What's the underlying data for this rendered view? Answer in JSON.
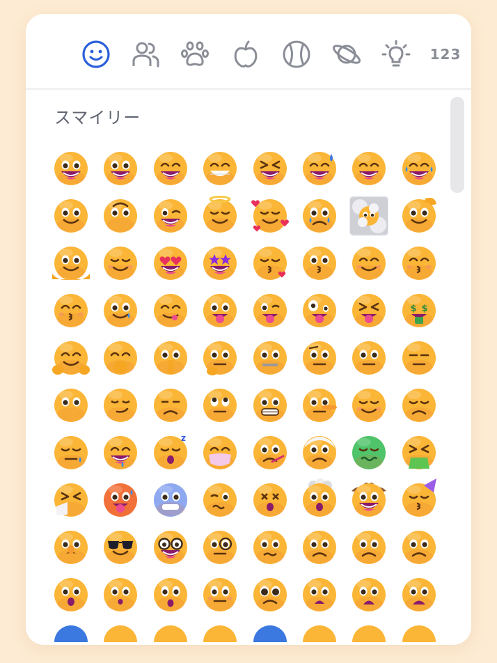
{
  "tabs": [
    {
      "name": "smileys-tab",
      "icon": "smiley-icon",
      "active": true
    },
    {
      "name": "people-tab",
      "icon": "people-icon"
    },
    {
      "name": "animals-tab",
      "icon": "paw-icon"
    },
    {
      "name": "food-tab",
      "icon": "apple-icon"
    },
    {
      "name": "activities-tab",
      "icon": "ball-icon"
    },
    {
      "name": "travel-tab",
      "icon": "planet-icon"
    },
    {
      "name": "objects-tab",
      "icon": "lightbulb-icon"
    },
    {
      "name": "symbols-tab",
      "icon": "numbers-icon",
      "label": "123"
    }
  ],
  "section": {
    "title": "スマイリー"
  },
  "colors": {
    "accent": "#2b5fd9",
    "tab_gray": "#8a8d96",
    "face": "#fbb637",
    "bg": "#fdebd3"
  },
  "emojis": [
    {
      "name": "grinning-face",
      "kind": "grin",
      "color": "#fbb637"
    },
    {
      "name": "grinning-face-big-eyes",
      "kind": "grin",
      "color": "#fbb637"
    },
    {
      "name": "grinning-face-smiling-eyes",
      "kind": "happyeyes",
      "color": "#fbb637"
    },
    {
      "name": "beaming-face",
      "kind": "beam",
      "color": "#fbb637"
    },
    {
      "name": "grinning-squinting-face",
      "kind": "squint",
      "color": "#fbb637"
    },
    {
      "name": "grinning-face-sweat",
      "kind": "sweat",
      "color": "#fbb637"
    },
    {
      "name": "rolling-on-floor-laughing",
      "kind": "rofl",
      "color": "#fbb637"
    },
    {
      "name": "face-tears-of-joy",
      "kind": "tears",
      "color": "#fbb637"
    },
    {
      "name": "slightly-smiling-face",
      "kind": "slight",
      "color": "#fbb637"
    },
    {
      "name": "upside-down-face",
      "kind": "upside",
      "color": "#fbb637"
    },
    {
      "name": "winking-face",
      "kind": "wink",
      "color": "#fbb637"
    },
    {
      "name": "smiling-face-halo",
      "kind": "halo",
      "color": "#fbb637"
    },
    {
      "name": "smiling-face-hearts",
      "kind": "hearts",
      "color": "#fbb637"
    },
    {
      "name": "face-holding-back-tears",
      "kind": "holdtears",
      "color": "#fbb637"
    },
    {
      "name": "face-in-clouds",
      "kind": "clouds",
      "color": "#fbb637",
      "selected": true
    },
    {
      "name": "saluting-face",
      "kind": "salute",
      "color": "#fbb637"
    },
    {
      "name": "melting-face",
      "kind": "melt",
      "color": "#fbb637"
    },
    {
      "name": "smiling-face",
      "kind": "smile",
      "color": "#fbb637"
    },
    {
      "name": "smiling-face-heart-eyes",
      "kind": "hearteyes",
      "color": "#fbb637"
    },
    {
      "name": "star-struck",
      "kind": "stars",
      "color": "#fbb637"
    },
    {
      "name": "face-blowing-kiss",
      "kind": "kissheart",
      "color": "#fbb637"
    },
    {
      "name": "kissing-face",
      "kind": "kiss",
      "color": "#fbb637"
    },
    {
      "name": "smiling-face-closed-eyes",
      "kind": "smileclosed",
      "color": "#fbb637"
    },
    {
      "name": "kissing-face-smiling-eyes",
      "kind": "kissclosed",
      "color": "#fbb637"
    },
    {
      "name": "kissing-face-closed-eyes",
      "kind": "kissclosed",
      "color": "#fbb637"
    },
    {
      "name": "smiling-face-tear",
      "kind": "smiletear",
      "color": "#fbb637"
    },
    {
      "name": "face-savoring-food",
      "kind": "yum",
      "color": "#fbb637"
    },
    {
      "name": "face-with-tongue",
      "kind": "tongue",
      "color": "#fbb637"
    },
    {
      "name": "winking-face-tongue",
      "kind": "winktongue",
      "color": "#fbb637"
    },
    {
      "name": "zany-face",
      "kind": "zany",
      "color": "#fbb637"
    },
    {
      "name": "squinting-face-tongue",
      "kind": "squinttongue",
      "color": "#fbb637"
    },
    {
      "name": "money-mouth-face",
      "kind": "money",
      "color": "#fbb637"
    },
    {
      "name": "smiling-face-open-hands",
      "kind": "hug",
      "color": "#fbb637"
    },
    {
      "name": "face-hand-over-mouth",
      "kind": "handmouth",
      "color": "#fbb637"
    },
    {
      "name": "face-open-eyes-hand-over-mouth",
      "kind": "shush",
      "color": "#fbb637"
    },
    {
      "name": "thinking-face",
      "kind": "think",
      "color": "#fbb637"
    },
    {
      "name": "zipper-mouth-face",
      "kind": "zipper",
      "color": "#fbb637"
    },
    {
      "name": "face-raised-eyebrow",
      "kind": "eyebrow",
      "color": "#fbb637"
    },
    {
      "name": "neutral-face",
      "kind": "neutral",
      "color": "#fbb637"
    },
    {
      "name": "expressionless-face",
      "kind": "expressionless",
      "color": "#fbb637"
    },
    {
      "name": "face-without-mouth",
      "kind": "nomouth",
      "color": "#fbb637"
    },
    {
      "name": "smirking-face",
      "kind": "smirk",
      "color": "#fbb637"
    },
    {
      "name": "unamused-face",
      "kind": "unamused",
      "color": "#fbb637"
    },
    {
      "name": "face-rolling-eyes",
      "kind": "rolleyes",
      "color": "#fbb637"
    },
    {
      "name": "grimacing-face",
      "kind": "grimace",
      "color": "#fbb637"
    },
    {
      "name": "lying-face",
      "kind": "lying",
      "color": "#fbb637"
    },
    {
      "name": "relieved-face",
      "kind": "relieved",
      "color": "#fbb637"
    },
    {
      "name": "pensive-face",
      "kind": "pensive",
      "color": "#fbb637"
    },
    {
      "name": "sleepy-face",
      "kind": "sleepy",
      "color": "#fbb637"
    },
    {
      "name": "drooling-face",
      "kind": "drool",
      "color": "#fbb637"
    },
    {
      "name": "sleeping-face",
      "kind": "sleeping",
      "color": "#fbb637"
    },
    {
      "name": "face-medical-mask",
      "kind": "mask",
      "color": "#fbb637"
    },
    {
      "name": "face-thermometer",
      "kind": "thermo",
      "color": "#fbb637"
    },
    {
      "name": "face-head-bandage",
      "kind": "bandage",
      "color": "#fbb637"
    },
    {
      "name": "nauseated-face",
      "kind": "nausea",
      "color": "#4fc46a"
    },
    {
      "name": "face-vomiting",
      "kind": "vomit",
      "color": "#fbb637"
    },
    {
      "name": "sneezing-face",
      "kind": "sneeze",
      "color": "#fbb637"
    },
    {
      "name": "hot-face",
      "kind": "hot",
      "color": "#f2713a"
    },
    {
      "name": "cold-face",
      "kind": "cold",
      "color": "#8ea9f0"
    },
    {
      "name": "woozy-face",
      "kind": "woozy",
      "color": "#fbb637"
    },
    {
      "name": "face-crossed-out-eyes",
      "kind": "dizzy",
      "color": "#fbb637"
    },
    {
      "name": "exploding-head",
      "kind": "explode",
      "color": "#fbb637"
    },
    {
      "name": "cowboy-hat-face",
      "kind": "cowboy",
      "color": "#fbb637"
    },
    {
      "name": "partying-face",
      "kind": "party",
      "color": "#fbb637"
    },
    {
      "name": "disguised-face",
      "kind": "disguise",
      "color": "#fbb637"
    },
    {
      "name": "smiling-face-sunglasses",
      "kind": "sunglasses",
      "color": "#fbb637"
    },
    {
      "name": "nerd-face",
      "kind": "nerd",
      "color": "#fbb637"
    },
    {
      "name": "face-monocle",
      "kind": "monocle",
      "color": "#fbb637"
    },
    {
      "name": "confused-face",
      "kind": "confused",
      "color": "#fbb637"
    },
    {
      "name": "worried-face",
      "kind": "worried",
      "color": "#fbb637"
    },
    {
      "name": "slightly-frowning-face",
      "kind": "frownslight",
      "color": "#fbb637"
    },
    {
      "name": "frowning-face",
      "kind": "frown",
      "color": "#fbb637"
    },
    {
      "name": "face-open-mouth",
      "kind": "openmouth",
      "color": "#fbb637"
    },
    {
      "name": "hushed-face",
      "kind": "hushed",
      "color": "#fbb637"
    },
    {
      "name": "astonished-face",
      "kind": "astonished",
      "color": "#fbb637"
    },
    {
      "name": "flushed-face",
      "kind": "flushed",
      "color": "#fbb637"
    },
    {
      "name": "pleading-face",
      "kind": "pleading",
      "color": "#fbb637"
    },
    {
      "name": "frowning-face-open-mouth",
      "kind": "frownopen",
      "color": "#fbb637"
    },
    {
      "name": "anguished-face",
      "kind": "anguished",
      "color": "#fbb637"
    },
    {
      "name": "fearful-face",
      "kind": "fearful",
      "color": "#fbb637"
    },
    {
      "name": "anxious-face-sweat",
      "kind": "partial",
      "color": "#3b78e0"
    },
    {
      "name": "sad-relieved-face",
      "kind": "partial",
      "color": "#fbb637"
    },
    {
      "name": "crying-face",
      "kind": "partial",
      "color": "#fbb637"
    },
    {
      "name": "loudly-crying-face",
      "kind": "partial",
      "color": "#fbb637"
    },
    {
      "name": "face-screaming",
      "kind": "partial",
      "color": "#3b78e0"
    },
    {
      "name": "confounded-face",
      "kind": "partial",
      "color": "#fbb637"
    },
    {
      "name": "persevering-face",
      "kind": "partial",
      "color": "#fbb637"
    },
    {
      "name": "disappointed-face",
      "kind": "partial",
      "color": "#fbb637"
    }
  ]
}
